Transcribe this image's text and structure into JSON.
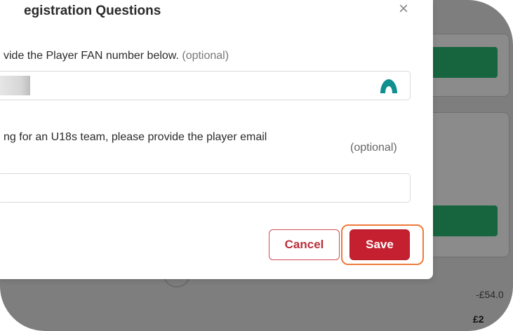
{
  "modal": {
    "title": "egistration Questions",
    "close_label": "×",
    "q1": {
      "label": "vide the Player FAN number below.",
      "optional": "(optional)"
    },
    "q2": {
      "label": "ng for an U18s team, please provide the player email",
      "optional": "(optional)",
      "value": ""
    },
    "buttons": {
      "cancel": "Cancel",
      "save": "Save"
    }
  },
  "background": {
    "price_discount": "-£54.0",
    "price_total": "£2"
  },
  "colors": {
    "primary_red": "#c4202f",
    "highlight_orange": "#ef7a3a",
    "bg_green": "#17653f",
    "extension_icon": "#0f8f8f"
  },
  "icons": {
    "close": "close-icon",
    "extension": "password-manager-icon"
  }
}
